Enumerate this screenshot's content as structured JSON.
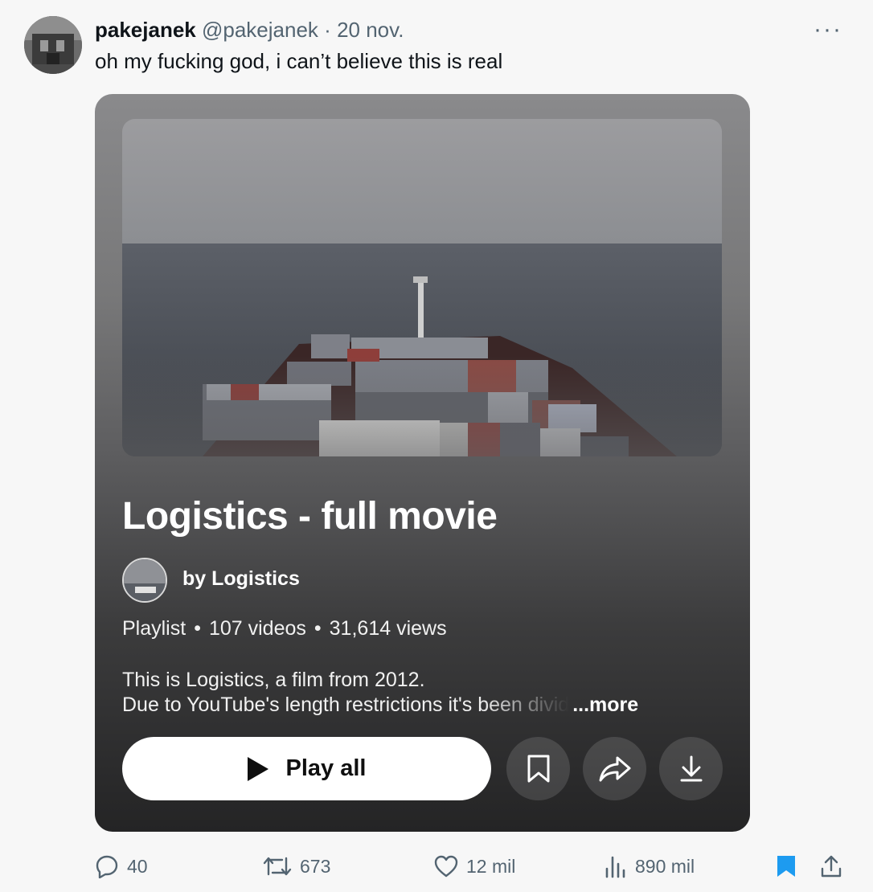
{
  "tweet": {
    "display_name": "pakejanek",
    "handle": "@pakejanek",
    "separator": "·",
    "date": "20 nov.",
    "more_label": "···",
    "text": "oh my fucking god, i can’t believe this is real"
  },
  "card": {
    "title": "Logistics - full movie",
    "owner": "by Logistics",
    "meta_type": "Playlist",
    "meta_sep": "•",
    "meta_videos": "107 videos",
    "meta_views": "31,614 views",
    "desc_line1": "This is Logistics, a film from 2012.",
    "desc_line2": "Due to YouTube's length restrictions it's been divid",
    "desc_more": "...more",
    "play_label": "Play all"
  },
  "actions": {
    "replies": "40",
    "reposts": "673",
    "likes": "12 mil",
    "views": "890 mil"
  },
  "colors": {
    "bookmark_active": "#1d9bf0",
    "muted_text": "#536471"
  },
  "icons": [
    "reply-icon",
    "repost-icon",
    "like-icon",
    "views-icon",
    "bookmark-icon",
    "share-icon",
    "save-playlist-icon",
    "share-arrow-icon",
    "download-icon",
    "play-icon"
  ]
}
